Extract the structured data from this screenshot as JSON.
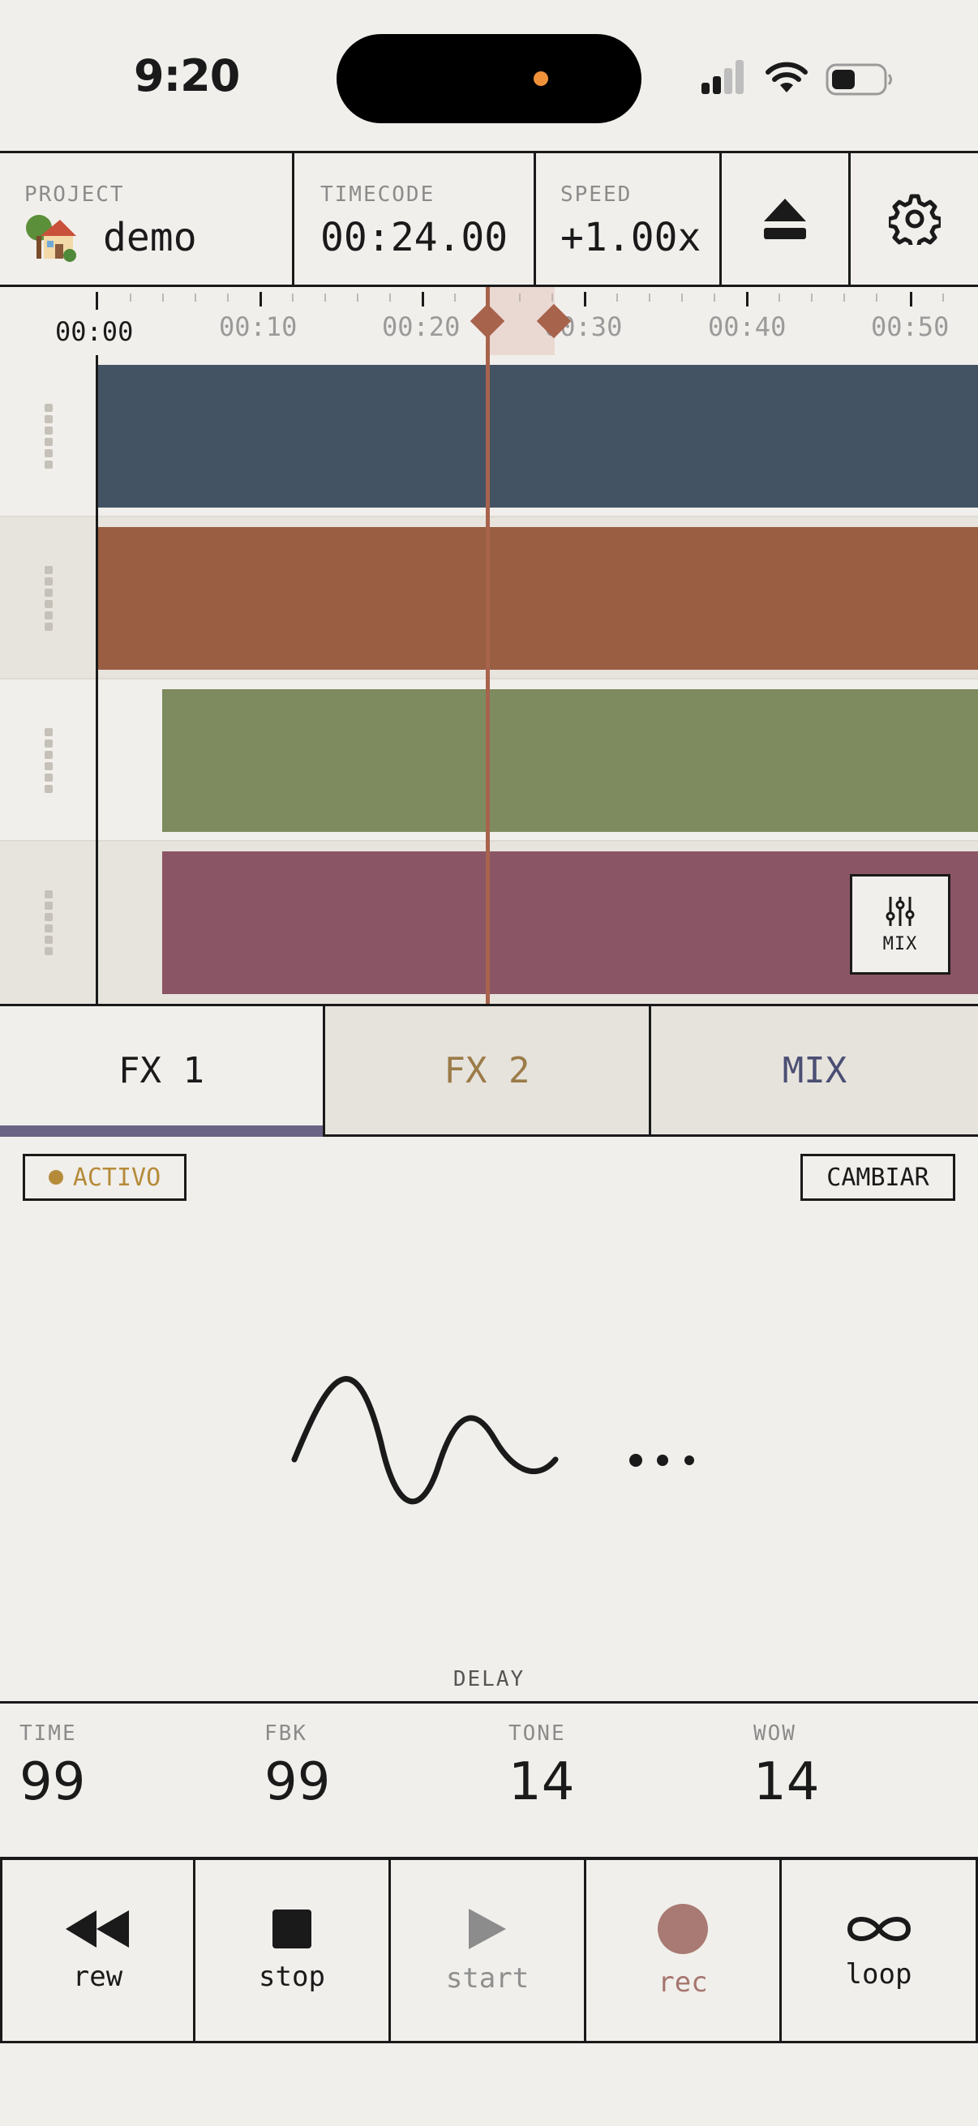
{
  "status_bar": {
    "time": "9:20"
  },
  "header": {
    "project_label": "PROJECT",
    "project_icon": "house-with-garden-emoji",
    "project_name": "demo",
    "timecode_label": "TIMECODE",
    "timecode": "00:24.00",
    "speed_label": "SPEED",
    "speed": "+1.00x",
    "eject_icon": "eject-icon",
    "settings_icon": "gear-icon"
  },
  "timeline": {
    "tick_labels": [
      "00:00",
      "00:10",
      "00:20",
      "00:30",
      "00:40",
      "00:50"
    ],
    "tracks": [
      {
        "color": "#435363"
      },
      {
        "color": "#9a5e43"
      },
      {
        "color": "#7d8b5f"
      },
      {
        "color": "#8a5564"
      }
    ],
    "mix_button_label": "MIX"
  },
  "tabs": [
    {
      "label": "FX 1",
      "color": "#1a1a1a",
      "active": true
    },
    {
      "label": "FX 2",
      "color": "#9b7b48",
      "active": false
    },
    {
      "label": "MIX",
      "color": "#4b4f73",
      "active": false
    }
  ],
  "fx": {
    "status": "ACTIVO",
    "change_label": "CAMBIAR",
    "effect_name": "DELAY",
    "params": [
      {
        "label": "TIME",
        "value": "99"
      },
      {
        "label": "FBK",
        "value": "99"
      },
      {
        "label": "TONE",
        "value": "14"
      },
      {
        "label": "WOW",
        "value": "14"
      }
    ]
  },
  "transport": [
    {
      "label": "rew",
      "icon": "rewind-icon"
    },
    {
      "label": "stop",
      "icon": "stop-icon"
    },
    {
      "label": "start",
      "icon": "play-icon"
    },
    {
      "label": "rec",
      "icon": "record-icon"
    },
    {
      "label": "loop",
      "icon": "infinity-icon"
    }
  ],
  "colors": {
    "accent": "#a8634d",
    "background": "#f1efeb",
    "active_badge": "#b58b3a",
    "tab_underline": "#6b6385"
  }
}
